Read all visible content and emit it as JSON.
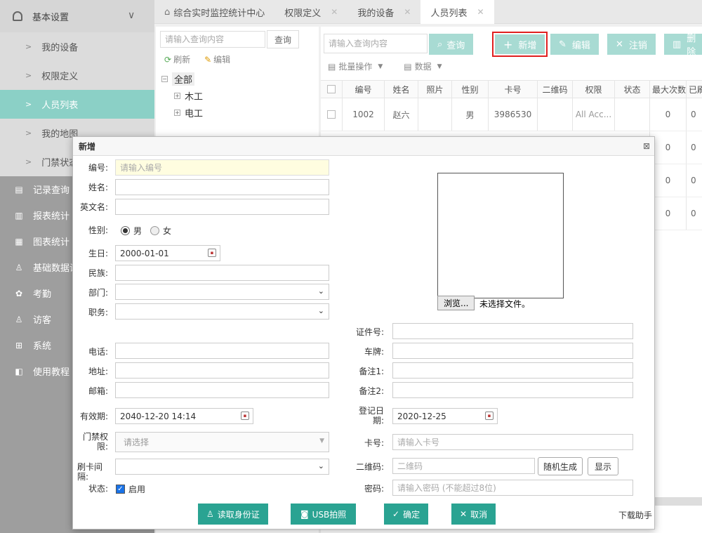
{
  "sidebar": {
    "section": {
      "label": "基本设置"
    },
    "subitems": [
      {
        "label": "我的设备"
      },
      {
        "label": "权限定义"
      },
      {
        "label": "人员列表"
      },
      {
        "label": "我的地图"
      },
      {
        "label": "门禁状态"
      }
    ],
    "items": [
      {
        "label": "记录查询",
        "icon": "search-icon"
      },
      {
        "label": "报表统计",
        "icon": "report-icon"
      },
      {
        "label": "图表统计",
        "icon": "chart-icon"
      },
      {
        "label": "基础数据设",
        "icon": "user-icon"
      },
      {
        "label": "考勤",
        "icon": "attendance-icon"
      },
      {
        "label": "访客",
        "icon": "visitor-icon"
      },
      {
        "label": "系统",
        "icon": "grid-icon"
      },
      {
        "label": "使用教程",
        "icon": "tutorial-icon"
      }
    ]
  },
  "tabs": [
    {
      "label": "综合实时监控统计中心"
    },
    {
      "label": "权限定义"
    },
    {
      "label": "我的设备"
    },
    {
      "label": "人员列表"
    }
  ],
  "left_panel": {
    "search_placeholder": "请输入查询内容",
    "search_button": "查询",
    "refresh": "刷新",
    "edit": "编辑",
    "tree": {
      "root": "全部",
      "children": [
        "木工",
        "电工"
      ]
    }
  },
  "toolbar": {
    "search_placeholder": "请输入查询内容",
    "query": "查询",
    "add": "新增",
    "edit": "编辑",
    "cancel": "注销",
    "delete": "删除",
    "batch": "批量操作",
    "data": "数据"
  },
  "grid": {
    "columns": [
      "编号",
      "姓名",
      "照片",
      "性别",
      "卡号",
      "二维码",
      "权限",
      "状态",
      "最大次数",
      "已刷"
    ],
    "rows": [
      {
        "id": "1002",
        "name": "赵六",
        "gender": "男",
        "card": "3986530",
        "perm": "All Acc...",
        "max": "0",
        "used": "0"
      },
      {
        "max": "0",
        "used": "0"
      },
      {
        "max": "0",
        "used": "0"
      },
      {
        "max": "0",
        "used": "0"
      }
    ]
  },
  "dialog": {
    "title": "新增",
    "labels": {
      "id": "编号:",
      "name": "姓名:",
      "ename": "英文名:",
      "gender": "性别:",
      "birthday": "生日:",
      "nation": "民族:",
      "dept": "部门:",
      "position": "职务:",
      "phone": "电话:",
      "address": "地址:",
      "email": "邮箱:",
      "expire": "有效期:",
      "access": "门禁权限:",
      "interval": "刷卡间隔:",
      "status": "状态:",
      "idcard": "证件号:",
      "plate": "车牌:",
      "note1": "备注1:",
      "note2": "备注2:",
      "regdate": "登记日期:",
      "cardno": "卡号:",
      "qrcode": "二维码:",
      "password": "密码:"
    },
    "values": {
      "id_placeholder": "请输入编号",
      "male": "男",
      "female": "女",
      "birthday": "2000-01-01",
      "expire": "2040-12-20 14:14",
      "access_placeholder": "请选择",
      "status_label": "启用",
      "regdate": "2020-12-25",
      "cardno_placeholder": "请输入卡号",
      "qrcode_placeholder": "二维码",
      "password_placeholder": "请输入密码 (不能超过8位)"
    },
    "browse": "浏览...",
    "no_file": "未选择文件。",
    "random_btn": "随机生成",
    "show_btn": "显示",
    "footer": {
      "read_id": "读取身份证",
      "usb_photo": "USB拍照",
      "ok": "确定",
      "cancel": "取消",
      "helper": "下载助手"
    }
  },
  "colors": {
    "accent": "#2aa392",
    "highlight_border": "#e02020",
    "sidebar_active": "#8bd0c6"
  }
}
